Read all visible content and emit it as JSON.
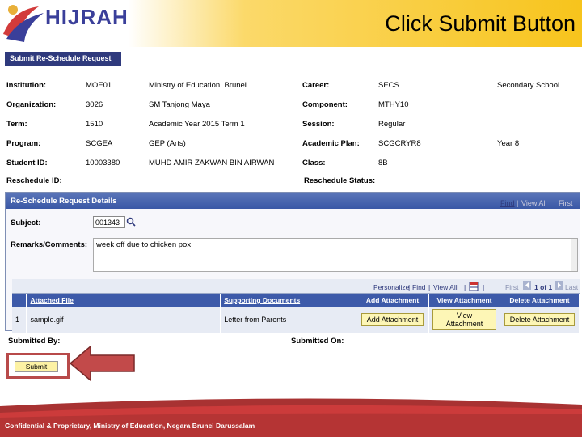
{
  "header": {
    "logo_text": "HIJRAH",
    "slide_title": "Click Submit Button"
  },
  "page_tab": "Submit Re-Schedule Request",
  "info": {
    "institution_label": "Institution:",
    "institution_code": "MOE01",
    "institution_name": "Ministry of Education, Brunei",
    "career_label": "Career:",
    "career_code": "SECS",
    "career_name": "Secondary School",
    "organization_label": "Organization:",
    "organization_code": "3026",
    "organization_name": "SM Tanjong Maya",
    "component_label": "Component:",
    "component_value": "MTHY10",
    "term_label": "Term:",
    "term_code": "1510",
    "term_name": "Academic Year 2015 Term 1",
    "session_label": "Session:",
    "session_value": "Regular",
    "program_label": "Program:",
    "program_code": "SCGEA",
    "program_name": "GEP (Arts)",
    "plan_label": "Academic Plan:",
    "plan_code": "SCGCRYR8",
    "plan_name": "Year 8",
    "student_id_label": "Student ID:",
    "student_id": "10003380",
    "student_name": "MUHD AMIR ZAKWAN BIN AIRWAN",
    "class_label": "Class:",
    "class_value": "8B",
    "reschedule_id_label": "Reschedule ID:",
    "reschedule_status_label": "Reschedule Status:"
  },
  "details": {
    "title": "Re-Schedule Request Details",
    "nav_find": "Find",
    "nav_view_all": "View All",
    "nav_first": "First",
    "subject_label": "Subject:",
    "subject_value": "001343",
    "remarks_label": "Remarks/Comments:",
    "remarks_value": "week off due to chicken pox"
  },
  "grid": {
    "nav_personalize": "Personalize",
    "nav_find": "Find",
    "nav_view_all": "View All",
    "nav_first": "First",
    "nav_range": "1 of 1",
    "nav_last": "Last",
    "headers": [
      "Attached File",
      "Supporting Documents",
      "Add Attachment",
      "View Attachment",
      "Delete Attachment"
    ],
    "row": {
      "index": "1",
      "file": "sample.gif",
      "document": "Letter from Parents",
      "add_btn": "Add Attachment",
      "view_btn": "View Attachment",
      "delete_btn": "Delete Attachment"
    }
  },
  "submitted_by_label": "Submitted By:",
  "submitted_on_label": "Submitted On:",
  "submit_button": "Submit",
  "footer_text": "Confidential & Proprietary, Ministry of Education, Negara Brunei Darussalam",
  "colors": {
    "accent": "#f7c41c",
    "brand_blue": "#2f3a7d",
    "grid_header": "#3d5aa9",
    "highlight_red": "#b84a4a"
  }
}
